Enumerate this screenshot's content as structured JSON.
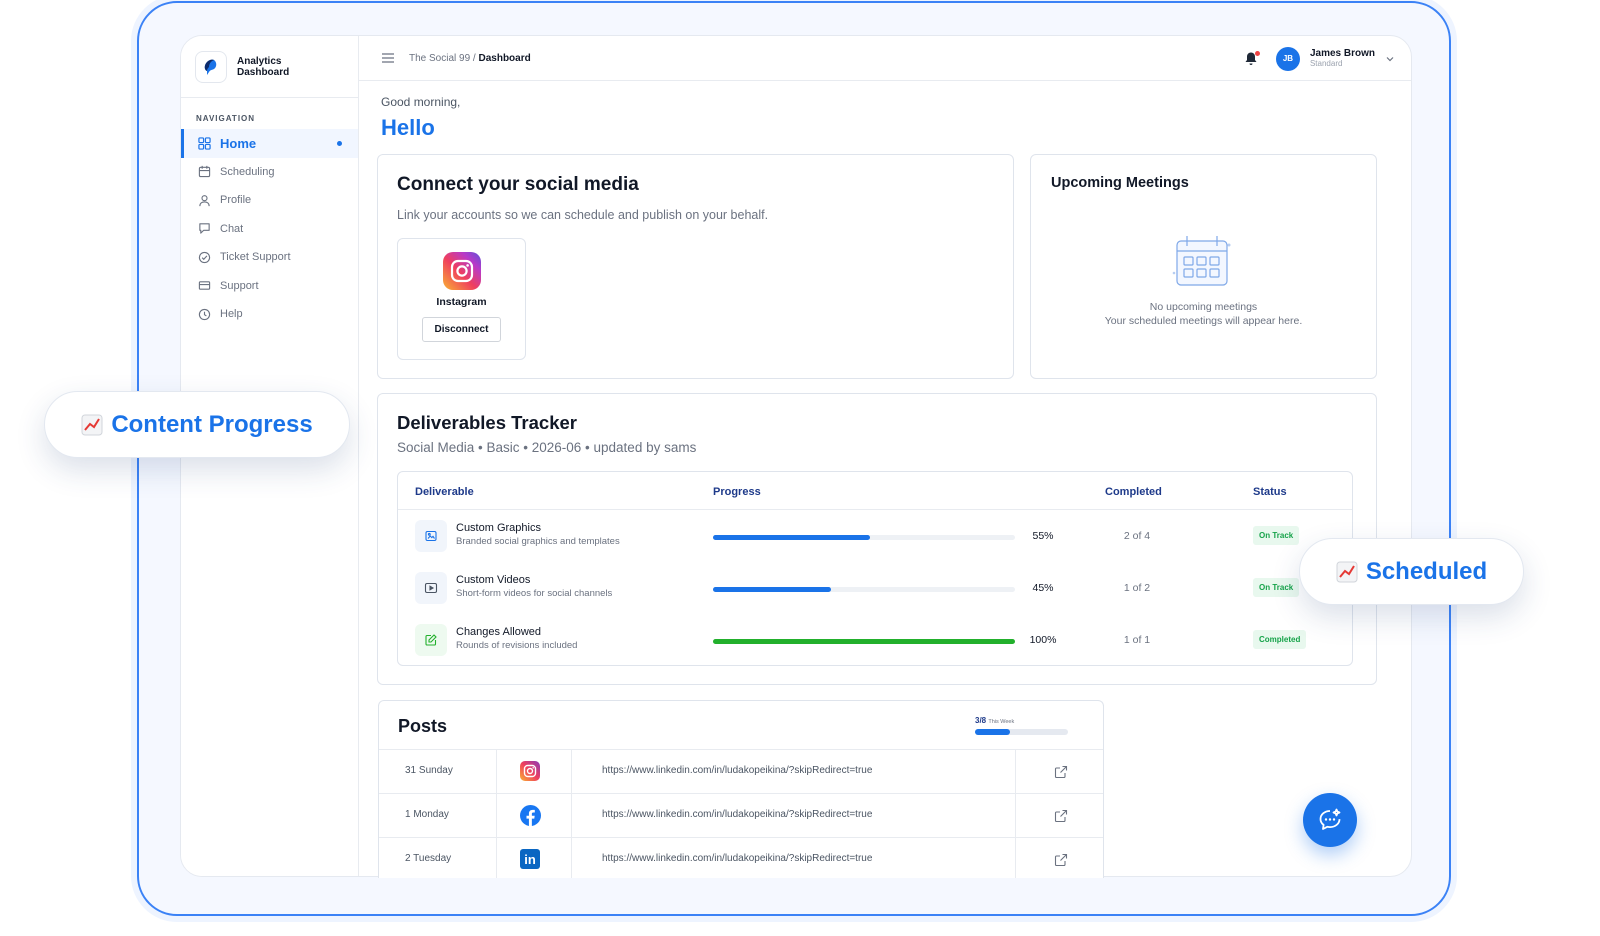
{
  "brand": {
    "line1": "Analytics",
    "line2": "Dashboard"
  },
  "navigation": {
    "title": "NAVIGATION",
    "items": [
      {
        "label": "Home",
        "icon": "grid-icon",
        "active": true
      },
      {
        "label": "Scheduling",
        "icon": "calendar-icon"
      },
      {
        "label": "Profile",
        "icon": "user-icon"
      },
      {
        "label": "Chat",
        "icon": "chat-icon"
      },
      {
        "label": "Ticket Support",
        "icon": "check-circle-icon"
      },
      {
        "label": "Support",
        "icon": "card-icon"
      },
      {
        "label": "Help",
        "icon": "clock-icon"
      }
    ]
  },
  "topbar": {
    "breadcrumb_parent": "The Social 99",
    "breadcrumb_sep": " / ",
    "breadcrumb_current": "Dashboard",
    "user_initials": "JB",
    "user_name": "James Brown",
    "user_plan": "Standard"
  },
  "greeting": {
    "small": "Good morning,",
    "large": "Hello"
  },
  "connect": {
    "title": "Connect your social media",
    "subtitle": "Link your accounts so we can schedule and publish on your behalf.",
    "account_name": "Instagram",
    "button_label": "Disconnect"
  },
  "meetings": {
    "title": "Upcoming Meetings",
    "empty_title": "No upcoming meetings",
    "empty_sub": "Your scheduled meetings will appear here."
  },
  "tracker": {
    "title": "Deliverables Tracker",
    "subtitle": "Social Media • Basic • 2026-06 • updated by sams",
    "columns": {
      "deliverable": "Deliverable",
      "progress": "Progress",
      "completed": "Completed",
      "status": "Status"
    },
    "rows": [
      {
        "title": "Custom Graphics",
        "sub": "Branded social graphics and templates",
        "progress": 0.52,
        "pct": "55%",
        "completed": "2 of 4",
        "status": "On Track",
        "color": "#1a73e8",
        "icon": "image-icon"
      },
      {
        "title": "Custom Videos",
        "sub": "Short-form videos for social channels",
        "progress": 0.39,
        "pct": "45%",
        "completed": "1 of 2",
        "status": "On Track",
        "color": "#1a73e8",
        "icon": "video-icon"
      },
      {
        "title": "Changes Allowed",
        "sub": "Rounds of revisions included",
        "progress": 1.0,
        "pct": "100%",
        "completed": "1 of 1",
        "status": "Completed",
        "color": "#22b02c",
        "icon": "edit-icon"
      }
    ]
  },
  "posts": {
    "title": "Posts",
    "week_count": "3/8",
    "week_label": "This Week",
    "week_progress": 0.375,
    "rows": [
      {
        "day": "31 Sunday",
        "network": "instagram-icon",
        "url": "https://www.linkedin.com/in/ludakopeikina/?skipRedirect=true"
      },
      {
        "day": "1 Monday",
        "network": "facebook-icon",
        "url": "https://www.linkedin.com/in/ludakopeikina/?skipRedirect=true"
      },
      {
        "day": "2 Tuesday",
        "network": "linkedin-icon",
        "url": "https://www.linkedin.com/in/ludakopeikina/?skipRedirect=true"
      }
    ]
  },
  "floating": {
    "left_label": "Content Progress",
    "right_label": "Scheduled"
  },
  "colors": {
    "accent": "#1a73e8",
    "success": "#22b02c"
  }
}
